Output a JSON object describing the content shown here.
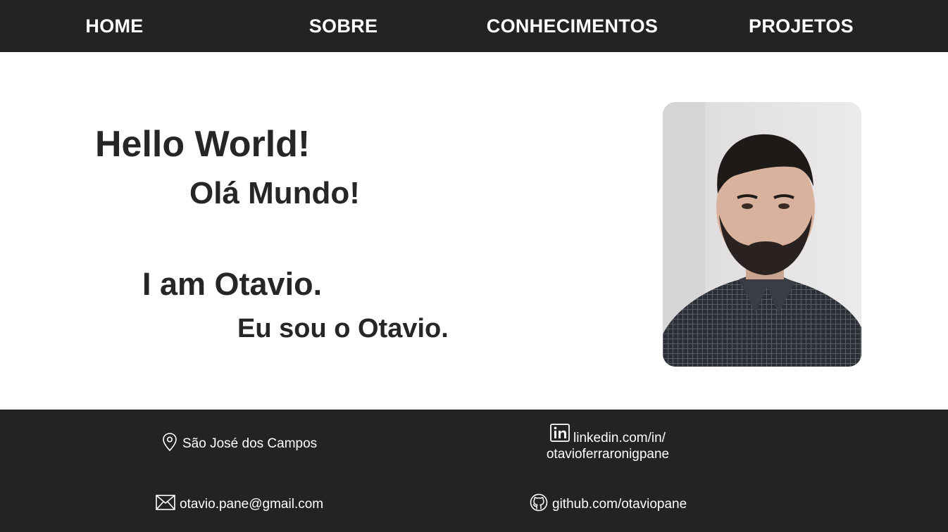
{
  "nav": {
    "items": [
      {
        "label": "HOME"
      },
      {
        "label": "SOBRE"
      },
      {
        "label": "CONHECIMENTOS"
      },
      {
        "label": "PROJETOS"
      }
    ]
  },
  "hero": {
    "greeting_en": "Hello World!",
    "greeting_pt": "Olá Mundo!",
    "intro_en": "I am Otavio.",
    "intro_pt": "Eu sou o Otavio."
  },
  "footer": {
    "location": {
      "icon": "map-pin-icon",
      "text": "São José dos Campos"
    },
    "linkedin": {
      "icon": "linkedin-icon",
      "line1": "linkedin.com/in/",
      "line2": "otavioferraronigpane"
    },
    "email": {
      "icon": "envelope-icon",
      "text": "otavio.pane@gmail.com"
    },
    "github": {
      "icon": "github-icon",
      "text": "github.com/otaviopane"
    }
  },
  "colors": {
    "bar_background": "#232323",
    "text_dark": "#262626",
    "text_light": "#ffffff"
  }
}
